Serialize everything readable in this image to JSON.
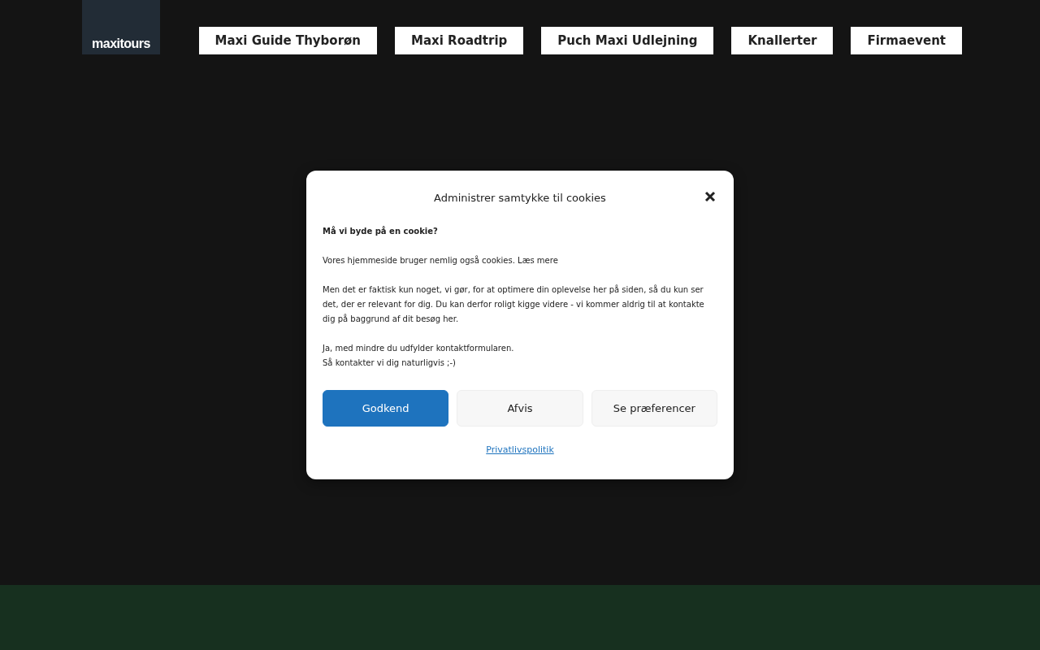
{
  "header": {
    "logo": "maxitours",
    "nav": [
      {
        "label": "Maxi Guide Thyborøn"
      },
      {
        "label": "Maxi Roadtrip"
      },
      {
        "label": "Puch Maxi Udlejning"
      },
      {
        "label": "Knallerter"
      },
      {
        "label": "Firmaevent"
      }
    ]
  },
  "cookie_dialog": {
    "title": "Administrer samtykke til cookies",
    "heading": "Må vi byde på en cookie?",
    "paragraphs": [
      [
        "Vores hjemmeside bruger nemlig også cookies. Læs mere"
      ],
      [
        "Men det er faktisk kun noget, vi gør, for at optimere din oplevelse her på siden, så du kun ser det, der er relevant for dig. Du kan derfor roligt kigge videre - vi kommer aldrig til at kontakte dig på baggrund af dit besøg her."
      ],
      [
        "Ja, med mindre du udfylder kontaktformularen.",
        "Så kontakter vi dig naturligvis ;-)"
      ]
    ],
    "buttons": [
      {
        "label": "Godkend",
        "kind": "primary"
      },
      {
        "label": "Afvis",
        "kind": "secondary"
      },
      {
        "label": "Se præferencer",
        "kind": "secondary"
      }
    ],
    "link": "Privatlivspolitik"
  }
}
